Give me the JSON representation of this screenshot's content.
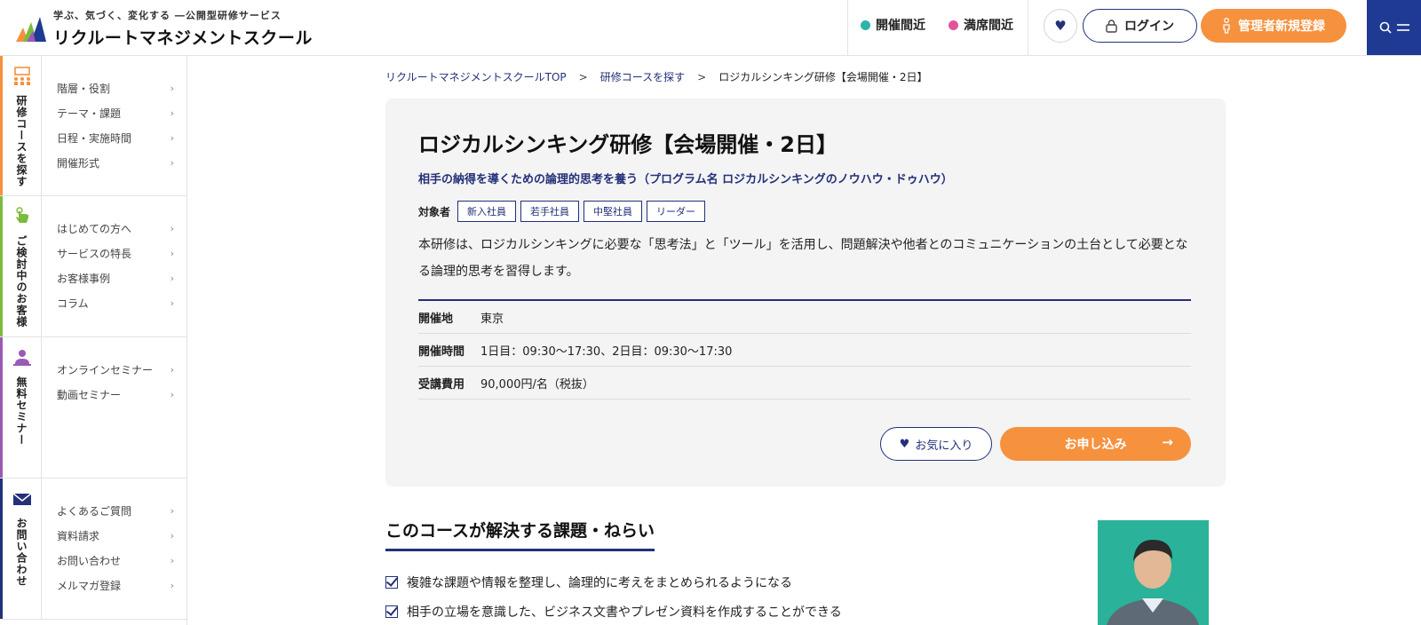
{
  "header": {
    "tagline": "学ぶ、気づく、変化する ―公開型研修サービス",
    "brand": "リクルートマネジメントスクール",
    "status_soon": "開催間近",
    "status_full": "満席間近",
    "login_label": "ログイン",
    "register_label": "管理者新規登録",
    "colors": {
      "soon": "#2cb5a8",
      "full": "#e0559a",
      "accent": "#f6913e",
      "navy": "#23307a"
    }
  },
  "sidebar": {
    "sections": [
      {
        "title": "研修コースを探す",
        "icon": "org-chart-icon",
        "color": "#f6913e",
        "items": [
          "階層・役割",
          "テーマ・課題",
          "日程・実施時間",
          "開催形式"
        ]
      },
      {
        "title": "ご検討中のお客様",
        "icon": "pointing-hand-icon",
        "color": "#7cba3c",
        "items": [
          "はじめての方へ",
          "サービスの特長",
          "お客様事例",
          "コラム"
        ]
      },
      {
        "title": "無料セミナー",
        "icon": "presenter-icon",
        "color": "#9b59b6",
        "items": [
          "オンラインセミナー",
          "動画セミナー"
        ]
      },
      {
        "title": "お問い合わせ",
        "icon": "mail-icon",
        "color": "#23307a",
        "items": [
          "よくあるご質問",
          "資料請求",
          "お問い合わせ",
          "メルマガ登録"
        ]
      }
    ]
  },
  "breadcrumb": {
    "home": "リクルートマネジメントスクールTOP",
    "search": "研修コースを探す",
    "current": "ロジカルシンキング研修【会場開催・2日】",
    "sep": ">"
  },
  "course": {
    "title": "ロジカルシンキング研修【会場開催・2日】",
    "subtitle": "相手の納得を導くための論理的思考を養う（プログラム名 ロジカルシンキングのノウハウ・ドゥハウ）",
    "target_label": "対象者",
    "targets": [
      "新入社員",
      "若手社員",
      "中堅社員",
      "リーダー"
    ],
    "description": "本研修は、ロジカルシンキングに必要な「思考法」と「ツール」を活用し、問題解決や他者とのコミュニケーションの土台として必要となる論理的思考を習得します。",
    "info": [
      {
        "label": "開催地",
        "value": "東京"
      },
      {
        "label": "開催時間",
        "value": "1日目：09:30〜17:30、2日目：09:30〜17:30"
      },
      {
        "label": "受講費用",
        "value": "90,000円/名（税抜）"
      }
    ],
    "favorite_label": "お気に入り",
    "apply_label": "お申し込み"
  },
  "goals": {
    "title": "このコースが解決する課題・ねらい",
    "items": [
      "複雑な課題や情報を整理し、論理的に考えをまとめられるようになる",
      "相手の立場を意識した、ビジネス文書やプレゼン資料を作成することができる"
    ]
  }
}
